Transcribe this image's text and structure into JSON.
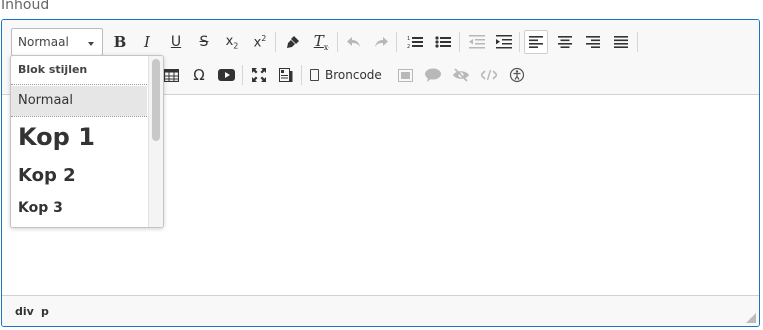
{
  "field_label": "Inhoud",
  "toolbar": {
    "format_combo_value": "Normaal",
    "source_label": "Broncode",
    "colors": {
      "icon": "#333333",
      "disabled": "#b8b8b8",
      "focus_border": "#1a73c9"
    }
  },
  "dropdown": {
    "header": "Blok stijlen",
    "items": [
      {
        "label": "Normaal",
        "selected": true
      },
      {
        "label": "Kop 1",
        "selected": false
      },
      {
        "label": "Kop 2",
        "selected": false
      },
      {
        "label": "Kop 3",
        "selected": false
      }
    ]
  },
  "statusbar": {
    "path": [
      "div",
      "p"
    ]
  }
}
